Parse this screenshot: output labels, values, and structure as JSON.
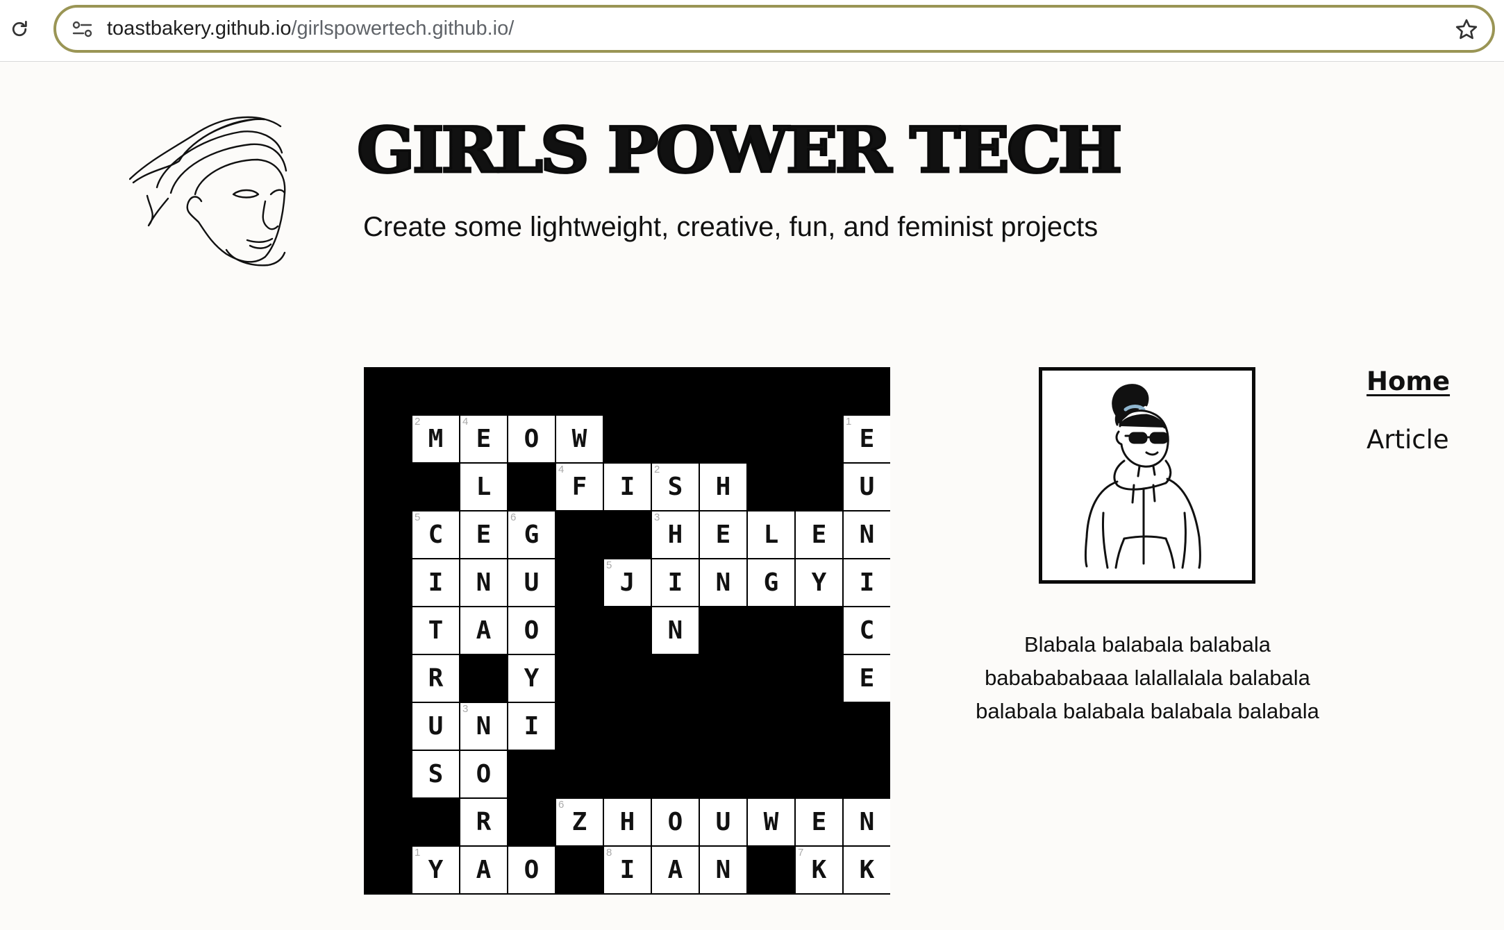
{
  "browser": {
    "url_host": "toastbakery.github.io",
    "url_path": "/girlspowertech.github.io/"
  },
  "header": {
    "title": "GIRLS POWER TECH",
    "tagline": "Create some lightweight, creative, fun, and feminist projects"
  },
  "nav": {
    "home": "Home",
    "article": "Article"
  },
  "profile": {
    "bio": "Blabala balabala balabala bababababaaa lalallalala balabala balabala balabala balabala balabala"
  },
  "crossword": {
    "cells": [
      {
        "r": 0,
        "c": 0,
        "ch": "M",
        "n": "2"
      },
      {
        "r": 0,
        "c": 1,
        "ch": "E",
        "n": "4"
      },
      {
        "r": 0,
        "c": 2,
        "ch": "O"
      },
      {
        "r": 0,
        "c": 3,
        "ch": "W"
      },
      {
        "r": 0,
        "c": 9,
        "ch": "E",
        "n": "1"
      },
      {
        "r": 1,
        "c": 1,
        "ch": "L"
      },
      {
        "r": 1,
        "c": 3,
        "ch": "F",
        "n": "4"
      },
      {
        "r": 1,
        "c": 4,
        "ch": "I"
      },
      {
        "r": 1,
        "c": 5,
        "ch": "S",
        "n": "2"
      },
      {
        "r": 1,
        "c": 6,
        "ch": "H"
      },
      {
        "r": 1,
        "c": 9,
        "ch": "U"
      },
      {
        "r": 2,
        "c": 0,
        "ch": "C",
        "n": "5"
      },
      {
        "r": 2,
        "c": 1,
        "ch": "E"
      },
      {
        "r": 2,
        "c": 2,
        "ch": "G",
        "n": "6"
      },
      {
        "r": 2,
        "c": 5,
        "ch": "H",
        "n": "3"
      },
      {
        "r": 2,
        "c": 6,
        "ch": "E"
      },
      {
        "r": 2,
        "c": 7,
        "ch": "L"
      },
      {
        "r": 2,
        "c": 8,
        "ch": "E"
      },
      {
        "r": 2,
        "c": 9,
        "ch": "N"
      },
      {
        "r": 3,
        "c": 0,
        "ch": "I"
      },
      {
        "r": 3,
        "c": 1,
        "ch": "N"
      },
      {
        "r": 3,
        "c": 2,
        "ch": "U"
      },
      {
        "r": 3,
        "c": 4,
        "ch": "J",
        "n": "5"
      },
      {
        "r": 3,
        "c": 5,
        "ch": "I"
      },
      {
        "r": 3,
        "c": 6,
        "ch": "N"
      },
      {
        "r": 3,
        "c": 7,
        "ch": "G"
      },
      {
        "r": 3,
        "c": 8,
        "ch": "Y"
      },
      {
        "r": 3,
        "c": 9,
        "ch": "I"
      },
      {
        "r": 4,
        "c": 0,
        "ch": "T"
      },
      {
        "r": 4,
        "c": 1,
        "ch": "A"
      },
      {
        "r": 4,
        "c": 2,
        "ch": "O"
      },
      {
        "r": 4,
        "c": 5,
        "ch": "N"
      },
      {
        "r": 4,
        "c": 9,
        "ch": "C"
      },
      {
        "r": 5,
        "c": 0,
        "ch": "R"
      },
      {
        "r": 5,
        "c": 2,
        "ch": "Y"
      },
      {
        "r": 5,
        "c": 9,
        "ch": "E"
      },
      {
        "r": 6,
        "c": 0,
        "ch": "U"
      },
      {
        "r": 6,
        "c": 1,
        "ch": "N",
        "n": "3"
      },
      {
        "r": 6,
        "c": 2,
        "ch": "I"
      },
      {
        "r": 7,
        "c": 0,
        "ch": "S"
      },
      {
        "r": 7,
        "c": 1,
        "ch": "O"
      },
      {
        "r": 8,
        "c": 1,
        "ch": "R"
      },
      {
        "r": 8,
        "c": 3,
        "ch": "Z",
        "n": "6"
      },
      {
        "r": 8,
        "c": 4,
        "ch": "H"
      },
      {
        "r": 8,
        "c": 5,
        "ch": "O"
      },
      {
        "r": 8,
        "c": 6,
        "ch": "U"
      },
      {
        "r": 8,
        "c": 7,
        "ch": "W"
      },
      {
        "r": 8,
        "c": 8,
        "ch": "E"
      },
      {
        "r": 8,
        "c": 9,
        "ch": "N"
      },
      {
        "r": 9,
        "c": 0,
        "ch": "Y",
        "n": "1"
      },
      {
        "r": 9,
        "c": 1,
        "ch": "A"
      },
      {
        "r": 9,
        "c": 2,
        "ch": "O"
      },
      {
        "r": 9,
        "c": 4,
        "ch": "I",
        "n": "8"
      },
      {
        "r": 9,
        "c": 5,
        "ch": "A"
      },
      {
        "r": 9,
        "c": 6,
        "ch": "N"
      },
      {
        "r": 9,
        "c": 8,
        "ch": "K",
        "n": "7"
      },
      {
        "r": 9,
        "c": 9,
        "ch": "K"
      }
    ]
  },
  "icons": {
    "reload": "reload-icon",
    "site_settings": "tune-icon",
    "bookmark": "star-icon",
    "logo": "woman-face-line-art",
    "avatar": "girl-sunglasses-hoodie"
  }
}
